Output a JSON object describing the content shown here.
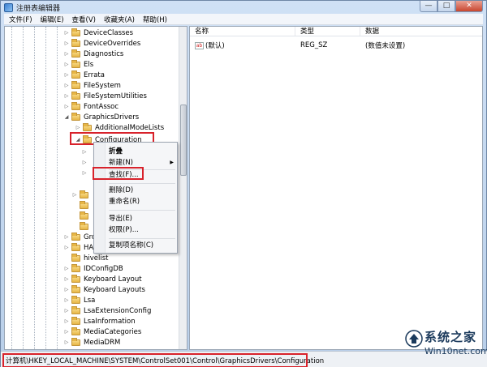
{
  "window": {
    "title": "注册表编辑器",
    "buttons": {
      "minimize": "—",
      "maximize": "□",
      "close": "✕"
    }
  },
  "menubar": {
    "items": [
      "文件(F)",
      "编辑(E)",
      "查看(V)",
      "收藏夹(A)",
      "帮助(H)"
    ]
  },
  "tree": {
    "items": [
      {
        "label": "DeviceClasses"
      },
      {
        "label": "DeviceOverrides"
      },
      {
        "label": "Diagnostics"
      },
      {
        "label": "Els"
      },
      {
        "label": "Errata"
      },
      {
        "label": "FileSystem"
      },
      {
        "label": "FileSystemUtilities"
      },
      {
        "label": "FontAssoc"
      },
      {
        "label": "GraphicsDrivers"
      },
      {
        "label": "AdditionalModeLists"
      },
      {
        "label": "Configuration"
      }
    ],
    "partial_items": [
      "Gro",
      "HA"
    ],
    "lower_items": [
      {
        "label": "hivelist"
      },
      {
        "label": "IDConfigDB"
      },
      {
        "label": "Keyboard Layout"
      },
      {
        "label": "Keyboard Layouts"
      },
      {
        "label": "Lsa"
      },
      {
        "label": "LsaExtensionConfig"
      },
      {
        "label": "LsaInformation"
      },
      {
        "label": "MediaCategories"
      },
      {
        "label": "MediaDRM"
      }
    ]
  },
  "list": {
    "headers": {
      "name": "名称",
      "type": "类型",
      "data": "数据"
    },
    "rows": [
      {
        "icon": "ab",
        "name": "(默认)",
        "type": "REG_SZ",
        "data": "(数值未设置)"
      }
    ]
  },
  "context_menu": {
    "items": [
      {
        "label": "折叠",
        "bold": true
      },
      {
        "label": "新建(N)",
        "submenu": true
      },
      {
        "label": "查找(F)..."
      },
      {
        "label": "删除(D)"
      },
      {
        "label": "重命名(R)"
      },
      {
        "label": "导出(E)"
      },
      {
        "label": "权限(P)..."
      },
      {
        "label": "复制项名称(C)"
      }
    ]
  },
  "statusbar": {
    "path": "计算机\\HKEY_LOCAL_MACHINE\\SYSTEM\\ControlSet001\\Control\\GraphicsDrivers\\Configuration"
  },
  "watermark": {
    "title": "系统之家",
    "sub": "Win10net.com"
  },
  "colors": {
    "highlight": "#d8222b",
    "folder": "#e7b646"
  }
}
